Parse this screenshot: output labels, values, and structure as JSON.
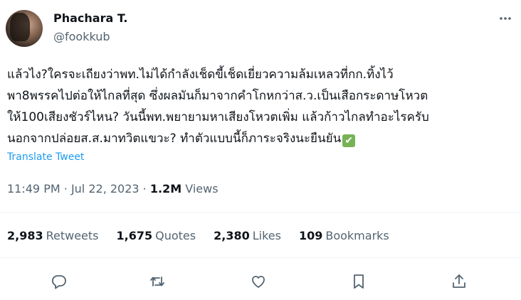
{
  "author": {
    "display_name": "Phachara T.",
    "handle": "@fookkub"
  },
  "tweet": {
    "text": "แล้วไง?ใครจะเถียงว่าพท.ไม่ได้กำลังเช็ดขี้เช็ดเยี่ยวความล้มเหลวที่กก.ทิ้งไว้\nพา8พรรคไปต่อให้ไกลที่สุด ซึ่งผลมันก็มาจากคำโกหกว่าส.ว.เป็นเสือกระดาษโหวต\nให้100เสียงชัวร์ไหน? วันนี้พท.พยายามหาเสียงโหวตเพิ่ม แล้วก้าวไกลทำอะไรครับ\nนอกจากปล่อยส.ส.มาทวิตแขวะ? ทำตัวแบบนี้ก็ภาระจริงนะยืนยัน",
    "emoji": "✔",
    "translate_label": "Translate Tweet"
  },
  "meta": {
    "time": "11:49 PM",
    "separator": "·",
    "date": "Jul 22, 2023",
    "views_count": "1.2M",
    "views_label": "Views"
  },
  "stats": {
    "retweets_count": "2,983",
    "retweets_label": "Retweets",
    "quotes_count": "1,675",
    "quotes_label": "Quotes",
    "likes_count": "2,380",
    "likes_label": "Likes",
    "bookmarks_count": "109",
    "bookmarks_label": "Bookmarks"
  },
  "icons": {
    "more": "more-icon",
    "reply": "reply-icon",
    "retweet": "retweet-icon",
    "like": "heart-icon",
    "bookmark": "bookmark-icon",
    "share": "share-icon"
  },
  "colors": {
    "link": "#1d9bf0",
    "secondary_text": "#536471",
    "primary_text": "#0f1419",
    "check_emoji": "#77b255"
  }
}
